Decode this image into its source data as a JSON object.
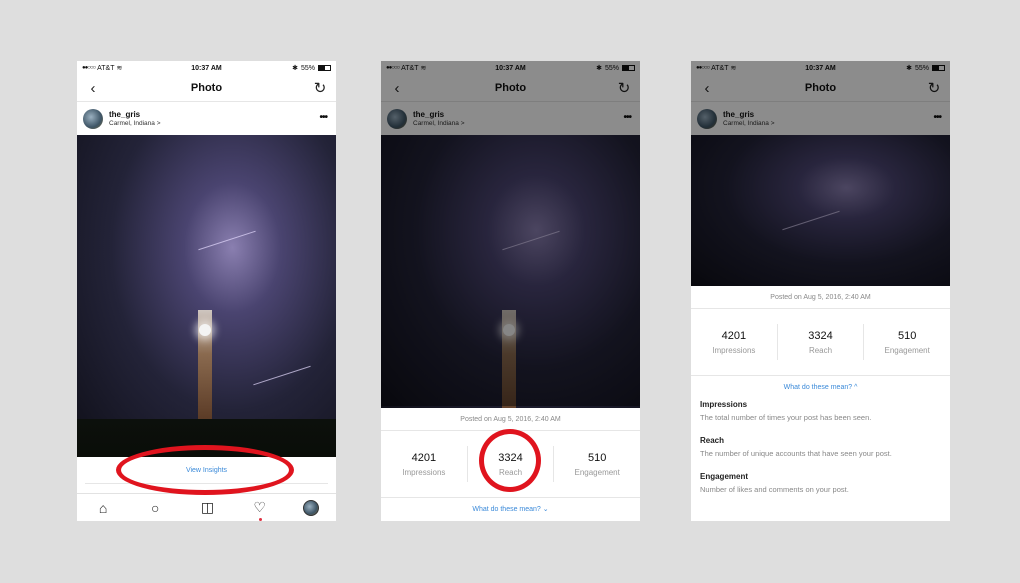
{
  "status": {
    "carrier": "AT&T",
    "time": "10:37 AM",
    "battery": "55%"
  },
  "nav": {
    "title": "Photo"
  },
  "post": {
    "username": "the_gris",
    "location": "Carmel, Indiana >",
    "posted_at": "Posted on Aug 5, 2016, 2:40 AM"
  },
  "insights": {
    "view_label": "View Insights",
    "what_mean_down": "What do these mean? ⌄",
    "what_mean_up": "What do these mean? ^",
    "metrics": [
      {
        "value": "4201",
        "label": "Impressions"
      },
      {
        "value": "3324",
        "label": "Reach"
      },
      {
        "value": "510",
        "label": "Engagement"
      }
    ],
    "definitions": [
      {
        "title": "Impressions",
        "text": "The total number of times your post has been seen."
      },
      {
        "title": "Reach",
        "text": "The number of unique accounts that have seen your post."
      },
      {
        "title": "Engagement",
        "text": "Number of likes and comments on your post."
      }
    ]
  },
  "icons": {
    "back": "back-arrow-icon",
    "refresh": "refresh-icon",
    "home": "home-icon",
    "search": "search-icon",
    "camera": "camera-icon",
    "heart": "heart-icon"
  },
  "colors": {
    "link": "#3b8ad9",
    "annotation": "#e0141e",
    "background": "#dedede"
  }
}
